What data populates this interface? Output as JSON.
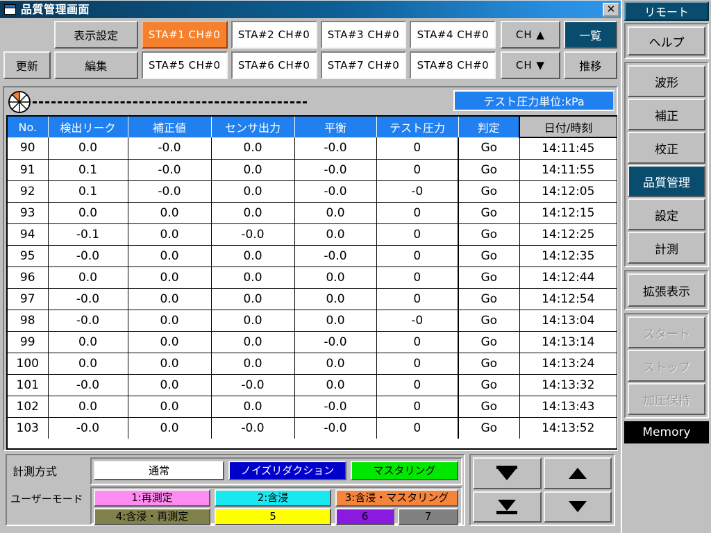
{
  "window": {
    "title": "品質管理画面",
    "icon": "window-icon",
    "close_label": "✕"
  },
  "toolbar": {
    "update_label": "更新",
    "display_settings_label": "表示設定",
    "edit_label": "編集",
    "station_buttons": [
      {
        "label": "STA#1 CH#0",
        "selected": true
      },
      {
        "label": "STA#2 CH#0",
        "selected": false
      },
      {
        "label": "STA#3 CH#0",
        "selected": false
      },
      {
        "label": "STA#4 CH#0",
        "selected": false
      },
      {
        "label": "STA#5 CH#0",
        "selected": false
      },
      {
        "label": "STA#6 CH#0",
        "selected": false
      },
      {
        "label": "STA#7 CH#0",
        "selected": false
      },
      {
        "label": "STA#8 CH#0",
        "selected": false
      }
    ],
    "ch_up_label": "CH ▲",
    "ch_down_label": "CH ▼",
    "list_label": "一覧",
    "trend_label": "推移"
  },
  "status": {
    "pressure_unit_label": "テスト圧力単位:kPa",
    "pie_icon": "pie-progress-icon",
    "pie_accent": "#f5812f"
  },
  "table": {
    "columns": [
      "No.",
      "検出リーク",
      "補正値",
      "センサ出力",
      "平衡",
      "テスト圧力",
      "判定",
      "日付/時刻"
    ],
    "rows": [
      {
        "no": "90",
        "leak": "0.0",
        "correction": "-0.0",
        "sensor": "0.0",
        "balance": "-0.0",
        "test_pressure": "0",
        "judgement": "Go",
        "datetime": "14:11:45"
      },
      {
        "no": "91",
        "leak": "0.1",
        "correction": "-0.0",
        "sensor": "0.0",
        "balance": "-0.0",
        "test_pressure": "0",
        "judgement": "Go",
        "datetime": "14:11:55"
      },
      {
        "no": "92",
        "leak": "0.1",
        "correction": "-0.0",
        "sensor": "0.0",
        "balance": "-0.0",
        "test_pressure": "-0",
        "judgement": "Go",
        "datetime": "14:12:05"
      },
      {
        "no": "93",
        "leak": "0.0",
        "correction": "0.0",
        "sensor": "0.0",
        "balance": "0.0",
        "test_pressure": "0",
        "judgement": "Go",
        "datetime": "14:12:15"
      },
      {
        "no": "94",
        "leak": "-0.1",
        "correction": "0.0",
        "sensor": "-0.0",
        "balance": "0.0",
        "test_pressure": "0",
        "judgement": "Go",
        "datetime": "14:12:25"
      },
      {
        "no": "95",
        "leak": "-0.0",
        "correction": "0.0",
        "sensor": "0.0",
        "balance": "-0.0",
        "test_pressure": "0",
        "judgement": "Go",
        "datetime": "14:12:35"
      },
      {
        "no": "96",
        "leak": "0.0",
        "correction": "0.0",
        "sensor": "0.0",
        "balance": "0.0",
        "test_pressure": "0",
        "judgement": "Go",
        "datetime": "14:12:44"
      },
      {
        "no": "97",
        "leak": "-0.0",
        "correction": "0.0",
        "sensor": "0.0",
        "balance": "0.0",
        "test_pressure": "0",
        "judgement": "Go",
        "datetime": "14:12:54"
      },
      {
        "no": "98",
        "leak": "-0.0",
        "correction": "0.0",
        "sensor": "0.0",
        "balance": "0.0",
        "test_pressure": "-0",
        "judgement": "Go",
        "datetime": "14:13:04"
      },
      {
        "no": "99",
        "leak": "0.0",
        "correction": "0.0",
        "sensor": "0.0",
        "balance": "-0.0",
        "test_pressure": "0",
        "judgement": "Go",
        "datetime": "14:13:14"
      },
      {
        "no": "100",
        "leak": "0.0",
        "correction": "0.0",
        "sensor": "0.0",
        "balance": "0.0",
        "test_pressure": "0",
        "judgement": "Go",
        "datetime": "14:13:24"
      },
      {
        "no": "101",
        "leak": "-0.0",
        "correction": "0.0",
        "sensor": "-0.0",
        "balance": "0.0",
        "test_pressure": "0",
        "judgement": "Go",
        "datetime": "14:13:32"
      },
      {
        "no": "102",
        "leak": "0.0",
        "correction": "0.0",
        "sensor": "0.0",
        "balance": "-0.0",
        "test_pressure": "0",
        "judgement": "Go",
        "datetime": "14:13:43"
      },
      {
        "no": "103",
        "leak": "-0.0",
        "correction": "0.0",
        "sensor": "-0.0",
        "balance": "-0.0",
        "test_pressure": "0",
        "judgement": "Go",
        "datetime": "14:13:52"
      }
    ]
  },
  "modes": {
    "measure_label": "計測方式",
    "measure_buttons": [
      {
        "label": "通常",
        "bg": "#ffffff",
        "fg": "#000000"
      },
      {
        "label": "ノイズリダクション",
        "bg": "#0000cc",
        "fg": "#ffffff"
      },
      {
        "label": "マスタリング",
        "bg": "#00e800",
        "fg": "#000000"
      }
    ],
    "user_label": "ユーザーモード",
    "user_buttons": [
      {
        "label": "1:再測定",
        "bg": "#ff8cf0",
        "fg": "#000000"
      },
      {
        "label": "2:含浸",
        "bg": "#1ae8f0",
        "fg": "#000000"
      },
      {
        "label": "3:含浸・マスタリング",
        "bg": "#f5853c",
        "fg": "#000000"
      },
      {
        "label": "4:含浸・再測定",
        "bg": "#80804a",
        "fg": "#000000"
      },
      {
        "label": "5",
        "bg": "#ffff00",
        "fg": "#000000"
      },
      {
        "label": "6",
        "bg": "#8a1ae0",
        "fg": "#000000"
      },
      {
        "label": "7",
        "bg": "#808080",
        "fg": "#000000"
      }
    ]
  },
  "nav": {
    "first_label": "first-page",
    "prev_label": "prev-page",
    "last_label": "last-page",
    "next_label": "next-page"
  },
  "sidebar": {
    "remote_label": "リモート",
    "help_label": "ヘルプ",
    "items": [
      {
        "label": "波形",
        "selected": false,
        "disabled": false
      },
      {
        "label": "補正",
        "selected": false,
        "disabled": false
      },
      {
        "label": "校正",
        "selected": false,
        "disabled": false
      },
      {
        "label": "品質管理",
        "selected": true,
        "disabled": false
      },
      {
        "label": "設定",
        "selected": false,
        "disabled": false
      },
      {
        "label": "計測",
        "selected": false,
        "disabled": false
      }
    ],
    "expand_label": "拡張表示",
    "control_items": [
      {
        "label": "スタート",
        "disabled": true
      },
      {
        "label": "ストップ",
        "disabled": true
      }
    ],
    "hold_label": "加圧保持",
    "memory_label": "Memory"
  }
}
